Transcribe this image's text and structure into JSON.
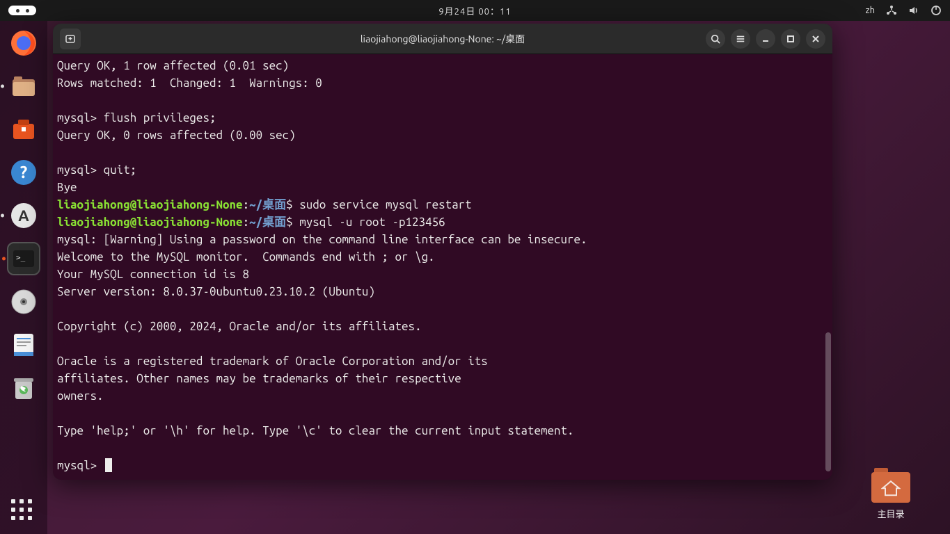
{
  "topbar": {
    "datetime": "9月24日 00：11",
    "input_method": "zh"
  },
  "dock": {
    "apps": [
      {
        "name": "firefox"
      },
      {
        "name": "files"
      },
      {
        "name": "software-store"
      },
      {
        "name": "help"
      },
      {
        "name": "software-updater"
      },
      {
        "name": "terminal"
      },
      {
        "name": "disc-burner"
      },
      {
        "name": "text-editor"
      },
      {
        "name": "trash"
      }
    ]
  },
  "desktop": {
    "home_folder_label": "主目录"
  },
  "terminal": {
    "title": "liaojiahong@liaojiahong-None: ~/桌面",
    "prompt_user_host": "liaojiahong@liaojiahong-None",
    "prompt_path": "~/桌面",
    "lines": {
      "l1": "Query OK, 1 row affected (0.01 sec)",
      "l2": "Rows matched: 1  Changed: 1  Warnings: 0",
      "l3": "",
      "l4": "mysql> flush privileges;",
      "l5": "Query OK, 0 rows affected (0.00 sec)",
      "l6": "",
      "l7": "mysql> quit;",
      "l8": "Bye",
      "cmd1": "sudo service mysql restart",
      "cmd2": "mysql -u root -p123456",
      "l11": "mysql: [Warning] Using a password on the command line interface can be insecure.",
      "l12": "Welcome to the MySQL monitor.  Commands end with ; or \\g.",
      "l13": "Your MySQL connection id is 8",
      "l14": "Server version: 8.0.37-0ubuntu0.23.10.2 (Ubuntu)",
      "l15": "",
      "l16": "Copyright (c) 2000, 2024, Oracle and/or its affiliates.",
      "l17": "",
      "l18": "Oracle is a registered trademark of Oracle Corporation and/or its",
      "l19": "affiliates. Other names may be trademarks of their respective",
      "l20": "owners.",
      "l21": "",
      "l22": "Type 'help;' or '\\h' for help. Type '\\c' to clear the current input statement.",
      "l23": "",
      "prompt": "mysql> "
    }
  }
}
